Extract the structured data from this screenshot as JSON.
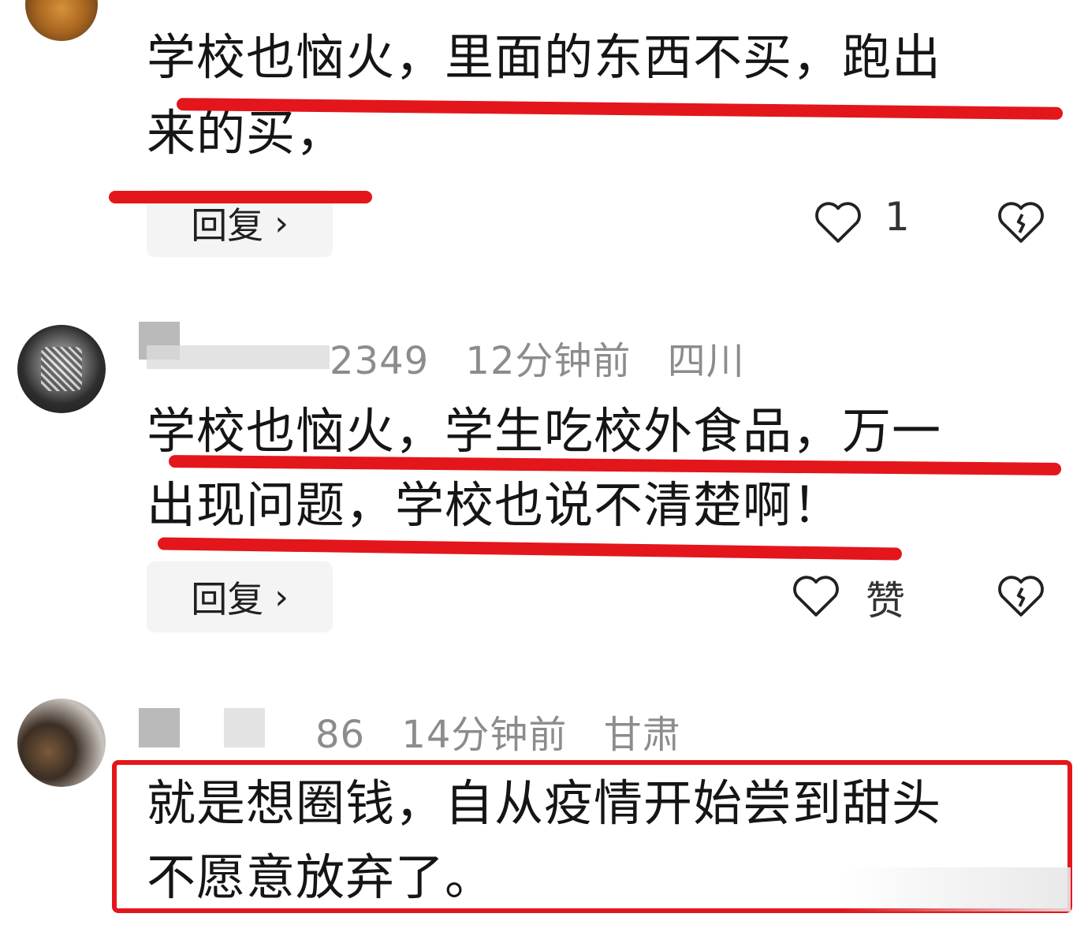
{
  "comments": [
    {
      "text_lines": [
        "学校也恼火，里面的东西不买，跑出",
        "来的买，"
      ],
      "reply_label": "回复",
      "like_count": "1"
    },
    {
      "username": "2349",
      "time": "12分钟前",
      "location": "四川",
      "text_lines": [
        "学校也恼火，学生吃校外食品，万一",
        "出现问题，学校也说不清楚啊！"
      ],
      "reply_label": "回复",
      "like_label": "赞"
    },
    {
      "username": "86",
      "time": "14分钟前",
      "location": "甘肃",
      "text_lines": [
        "就是想圈钱，自从疫情开始尝到甜头",
        "不愿意放弃了。"
      ]
    }
  ],
  "icons": {
    "like": "heart-outline-icon",
    "dislike": "broken-heart-icon",
    "reply_chevron": "chevron-right-icon"
  },
  "colors": {
    "annotation_red": "#e3161b",
    "meta_gray": "#8c8c8c"
  }
}
